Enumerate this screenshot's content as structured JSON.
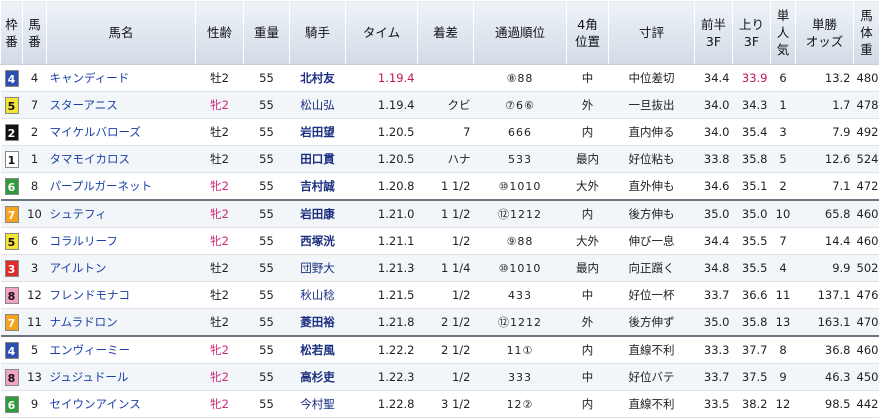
{
  "headers": [
    "枠\n番",
    "馬\n番",
    "馬名",
    "性齢",
    "重量",
    "騎手",
    "タイム",
    "着差",
    "通過順位",
    "4角\n位置",
    "寸評",
    "前半\n3F",
    "上り\n3F",
    "単\n人\n気",
    "単勝\nオッズ",
    "馬\n体\n重"
  ],
  "colors": {
    "waku": {
      "1": "#ffffff",
      "2": "#111111",
      "3": "#e12a2a",
      "4": "#2c4fb4",
      "5": "#f4e534",
      "6": "#2f9a3e",
      "7": "#f6a21d",
      "8": "#f2a4c4"
    }
  },
  "rows": [
    {
      "waku": "4",
      "num": "4",
      "horse": "キャンディード",
      "sex": "牡2",
      "female": false,
      "weight": "55",
      "jockey": "北村友",
      "jbold": true,
      "time": "1.19.4",
      "time_red": true,
      "margin": "",
      "passing": "⑧88",
      "corner": "中",
      "comment": "中位差切",
      "first3f": "34.4",
      "last3f": "33.9",
      "last_red": true,
      "pop": "6",
      "odds": "13.2",
      "bw": "480"
    },
    {
      "waku": "5",
      "num": "7",
      "horse": "スターアニス",
      "sex": "牝2",
      "female": true,
      "weight": "55",
      "jockey": "松山弘",
      "jbold": false,
      "time": "1.19.4",
      "time_red": false,
      "margin": "クビ",
      "passing": "⑦6⑥",
      "corner": "外",
      "comment": "一旦抜出",
      "first3f": "34.0",
      "last3f": "34.3",
      "last_red": false,
      "pop": "1",
      "odds": "1.7",
      "bw": "478"
    },
    {
      "waku": "2",
      "num": "2",
      "horse": "マイケルバローズ",
      "sex": "牡2",
      "female": false,
      "weight": "55",
      "jockey": "岩田望",
      "jbold": true,
      "time": "1.20.5",
      "time_red": false,
      "margin": "7",
      "passing": "666",
      "corner": "内",
      "comment": "直内伸る",
      "first3f": "34.0",
      "last3f": "35.4",
      "last_red": false,
      "pop": "3",
      "odds": "7.9",
      "bw": "492"
    },
    {
      "waku": "1",
      "num": "1",
      "horse": "タマモイカロス",
      "sex": "牡2",
      "female": false,
      "weight": "55",
      "jockey": "田口貫",
      "jbold": true,
      "time": "1.20.5",
      "time_red": false,
      "margin": "ハナ",
      "passing": "533",
      "corner": "最内",
      "comment": "好位粘も",
      "first3f": "33.8",
      "last3f": "35.8",
      "last_red": false,
      "pop": "5",
      "odds": "12.6",
      "bw": "524"
    },
    {
      "waku": "6",
      "num": "8",
      "horse": "パープルガーネット",
      "sex": "牝2",
      "female": true,
      "weight": "55",
      "jockey": "吉村誠",
      "jbold": true,
      "time": "1.20.8",
      "time_red": false,
      "margin": "1 1/2",
      "passing": "⑩1010",
      "corner": "大外",
      "comment": "直外伸も",
      "first3f": "34.6",
      "last3f": "35.1",
      "last_red": false,
      "pop": "2",
      "odds": "7.1",
      "bw": "472"
    },
    {
      "waku": "7",
      "num": "10",
      "horse": "シュテフィ",
      "sex": "牝2",
      "female": true,
      "weight": "55",
      "jockey": "岩田康",
      "jbold": true,
      "time": "1.21.0",
      "time_red": false,
      "margin": "1 1/2",
      "passing": "⑫1212",
      "corner": "内",
      "comment": "後方伸も",
      "first3f": "35.0",
      "last3f": "35.0",
      "last_red": false,
      "pop": "10",
      "odds": "65.8",
      "bw": "460"
    },
    {
      "waku": "5",
      "num": "6",
      "horse": "コラルリーフ",
      "sex": "牝2",
      "female": true,
      "weight": "55",
      "jockey": "西塚洸",
      "jbold": true,
      "time": "1.21.1",
      "time_red": false,
      "margin": "1/2",
      "passing": "⑨88",
      "corner": "大外",
      "comment": "伸び一息",
      "first3f": "34.4",
      "last3f": "35.5",
      "last_red": false,
      "pop": "7",
      "odds": "14.4",
      "bw": "460"
    },
    {
      "waku": "3",
      "num": "3",
      "horse": "アイルトン",
      "sex": "牡2",
      "female": false,
      "weight": "55",
      "jockey": "団野大",
      "jbold": false,
      "time": "1.21.3",
      "time_red": false,
      "margin": "1 1/4",
      "passing": "⑩1010",
      "corner": "最内",
      "comment": "向正躓く",
      "first3f": "34.8",
      "last3f": "35.5",
      "last_red": false,
      "pop": "4",
      "odds": "9.9",
      "bw": "502"
    },
    {
      "waku": "8",
      "num": "12",
      "horse": "フレンドモナコ",
      "sex": "牡2",
      "female": false,
      "weight": "55",
      "jockey": "秋山稔",
      "jbold": false,
      "time": "1.21.5",
      "time_red": false,
      "margin": "1/2",
      "passing": "433",
      "corner": "中",
      "comment": "好位一杯",
      "first3f": "33.7",
      "last3f": "36.6",
      "last_red": false,
      "pop": "11",
      "odds": "137.1",
      "bw": "476"
    },
    {
      "waku": "7",
      "num": "11",
      "horse": "ナムラドロン",
      "sex": "牡2",
      "female": false,
      "weight": "55",
      "jockey": "菱田裕",
      "jbold": true,
      "time": "1.21.8",
      "time_red": false,
      "margin": "2 1/2",
      "passing": "⑫1212",
      "corner": "外",
      "comment": "後方伸ず",
      "first3f": "35.0",
      "last3f": "35.8",
      "last_red": false,
      "pop": "13",
      "odds": "163.1",
      "bw": "470"
    },
    {
      "waku": "4",
      "num": "5",
      "horse": "エンヴィーミー",
      "sex": "牝2",
      "female": true,
      "weight": "55",
      "jockey": "松若風",
      "jbold": true,
      "time": "1.22.2",
      "time_red": false,
      "margin": "2 1/2",
      "passing": "11①",
      "corner": "内",
      "comment": "直線不利",
      "first3f": "33.3",
      "last3f": "37.7",
      "last_red": false,
      "pop": "8",
      "odds": "36.8",
      "bw": "460"
    },
    {
      "waku": "8",
      "num": "13",
      "horse": "ジュジュドール",
      "sex": "牝2",
      "female": true,
      "weight": "55",
      "jockey": "高杉吏",
      "jbold": true,
      "time": "1.22.3",
      "time_red": false,
      "margin": "1/2",
      "passing": "333",
      "corner": "中",
      "comment": "好位バテ",
      "first3f": "33.7",
      "last3f": "37.5",
      "last_red": false,
      "pop": "9",
      "odds": "46.3",
      "bw": "450"
    },
    {
      "waku": "6",
      "num": "9",
      "horse": "セイウンアインス",
      "sex": "牝2",
      "female": true,
      "weight": "55",
      "jockey": "今村聖",
      "jbold": false,
      "time": "1.22.8",
      "time_red": false,
      "margin": "3 1/2",
      "passing": "12②",
      "corner": "内",
      "comment": "直線不利",
      "first3f": "33.5",
      "last3f": "38.2",
      "last_red": false,
      "pop": "12",
      "odds": "98.5",
      "bw": "442"
    }
  ]
}
